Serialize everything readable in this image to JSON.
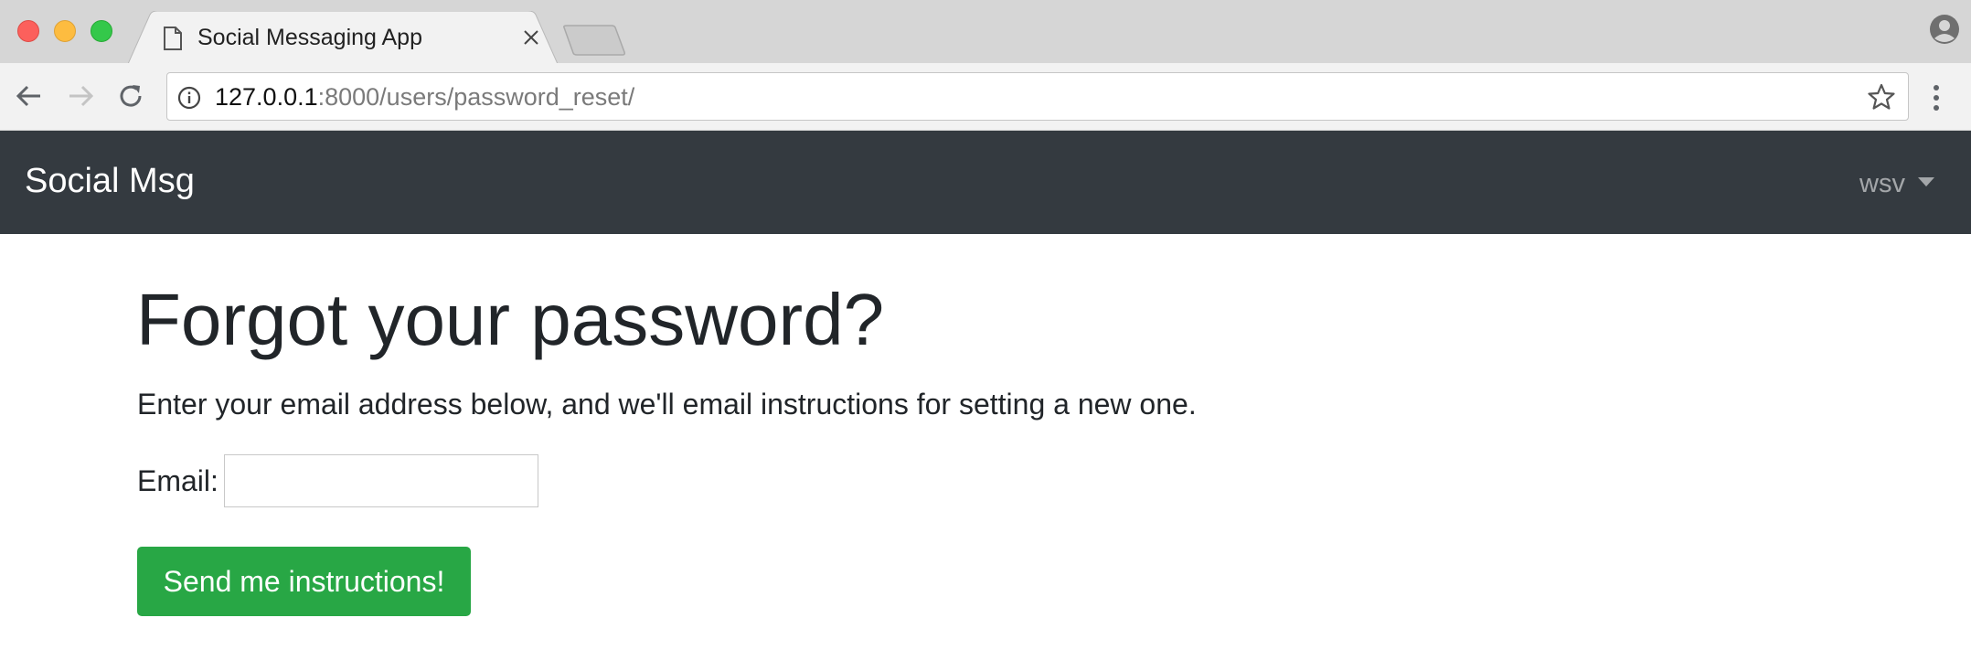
{
  "browser": {
    "tab_title": "Social Messaging App",
    "url_host": "127.0.0.1",
    "url_path": ":8000/users/password_reset/"
  },
  "navbar": {
    "brand": "Social Msg",
    "username": "wsv"
  },
  "main": {
    "heading": "Forgot your password?",
    "instructions": "Enter your email address below, and we'll email instructions for setting a new one.",
    "email_label": "Email:",
    "email_value": "",
    "submit_label": "Send me instructions!"
  },
  "colors": {
    "navbar_bg": "#343a40",
    "success_button": "#28a745",
    "text": "#212529"
  }
}
